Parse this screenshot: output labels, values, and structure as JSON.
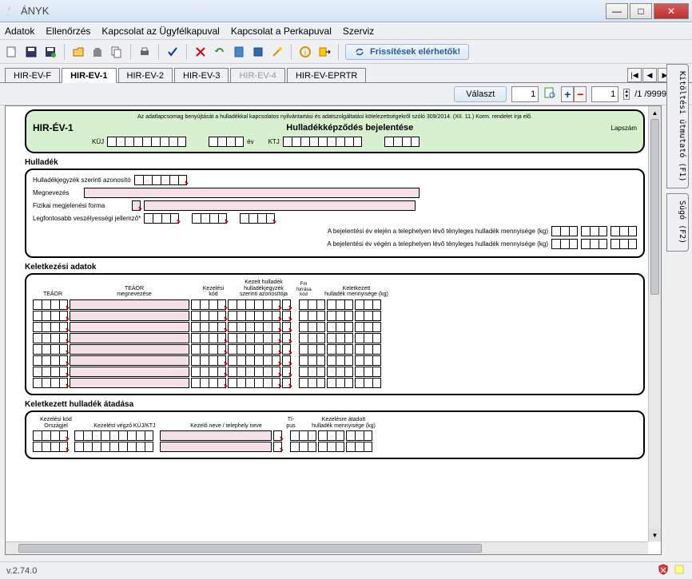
{
  "window": {
    "title": "ÁNYK"
  },
  "menu": {
    "items": [
      "Adatok",
      "Ellenőrzés",
      "Kapcsolat az Ügyfélkapuval",
      "Kapcsolat a Perkapuval",
      "Szerviz"
    ]
  },
  "toolbar": {
    "refresh": "Frissítések elérhetők!"
  },
  "tabs": {
    "items": [
      {
        "label": "HIR-EV-F",
        "active": false
      },
      {
        "label": "HIR-EV-1",
        "active": true
      },
      {
        "label": "HIR-EV-2",
        "active": false
      },
      {
        "label": "HIR-EV-3",
        "active": false
      },
      {
        "label": "HIR-EV-4",
        "active": false,
        "disabled": true
      },
      {
        "label": "HIR-EV-EPRTR",
        "active": false
      }
    ]
  },
  "ctrl": {
    "valaszt": "Választ",
    "num1": "1",
    "num2": "1",
    "pageinfo": "/1 /9999"
  },
  "sidetabs": {
    "a": "Kitöltési útmutató (F1)",
    "b": "Súgó (F2)"
  },
  "status": {
    "version": "v.2.74.0"
  },
  "form": {
    "header_note": "Az adatlapcsomag benyújtását a hulladékkal kapcsolatos nyilvántartási és adatszolgáltatási kötelezettségekről szóló 309/2014. (XII. 11.) Korm. rendelet írja elő.",
    "name": "HIR-ÉV-1",
    "title": "Hulladékképződés bejelentése",
    "lapszam": "Lapszám",
    "kuj": "KÜJ",
    "ev": "év",
    "ktj": "KTJ",
    "sec_hulladek": "Hulladék",
    "id_label": "Hulladékjegyzék szerinti azonosító",
    "megnevezes": "Megnevezés",
    "fizikai": "Fizikai megjelenési forma",
    "veszely": "Legfontosabb veszélyességi jellemző*",
    "elej": "A bejelentési év elején a telephelyen lévő tényleges hulladék mennyisége (kg)",
    "veg": "A bejelentési év végén a telephelyen lévő tényleges hulladék mennyisége (kg)",
    "sec_kelet": "Keletkezési adatok",
    "col_teaor": "TEÁOR",
    "col_teaor_meg": "TEÁOR\nmegnevezése",
    "col_kez": "Kezelési\nkód",
    "col_kezh": "Kezelt hulladék\nhulladékjegyzék\nszerinti azonosítója",
    "col_fm": "Fm\nforrása\nkód",
    "col_kelh": "Keletkezett\nhulladék mennyisége (kg)",
    "sec_atad": "Keletkezett hulladék átadása",
    "col_kezk": "Kezelési kód\nOrszágjel",
    "col_vegzo": "Kezelést végző KÜJ/KTJ",
    "col_kezneve": "Kezelő neve / telephely neve",
    "col_tipus": "Tí-\npus",
    "col_atadott": "Kezelésre átadott\nhulladék mennyisége (kg)"
  }
}
